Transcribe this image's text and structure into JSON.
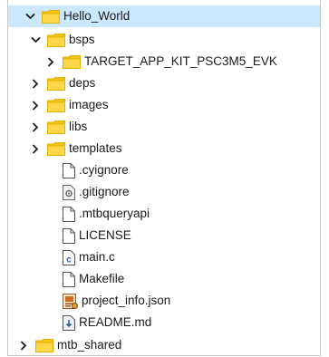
{
  "tree": {
    "root": {
      "label": "Hello_World",
      "expanded": true,
      "selected": true
    },
    "bsps": {
      "label": "bsps",
      "expanded": true
    },
    "target": {
      "label": "TARGET_APP_KIT_PSC3M5_EVK",
      "expanded": false
    },
    "deps": {
      "label": "deps",
      "expanded": false
    },
    "images": {
      "label": "images",
      "expanded": false
    },
    "libs": {
      "label": "libs",
      "expanded": false
    },
    "templates": {
      "label": "templates",
      "expanded": false
    },
    "files": [
      {
        "label": ".cyignore",
        "icon": "blank-file-icon"
      },
      {
        "label": ".gitignore",
        "icon": "settings-file-icon"
      },
      {
        "label": ".mtbqueryapi",
        "icon": "blank-file-icon"
      },
      {
        "label": "LICENSE",
        "icon": "blank-file-icon"
      },
      {
        "label": "main.c",
        "icon": "c-file-icon"
      },
      {
        "label": "Makefile",
        "icon": "blank-file-icon"
      },
      {
        "label": "project_info.json",
        "icon": "json-file-icon"
      },
      {
        "label": "README.md",
        "icon": "markdown-file-icon"
      }
    ],
    "shared": {
      "label": "mtb_shared",
      "expanded": false
    }
  },
  "colors": {
    "selection": "#cce8ff",
    "folder": "#f5c518",
    "chevron": "#1a1a1a"
  }
}
